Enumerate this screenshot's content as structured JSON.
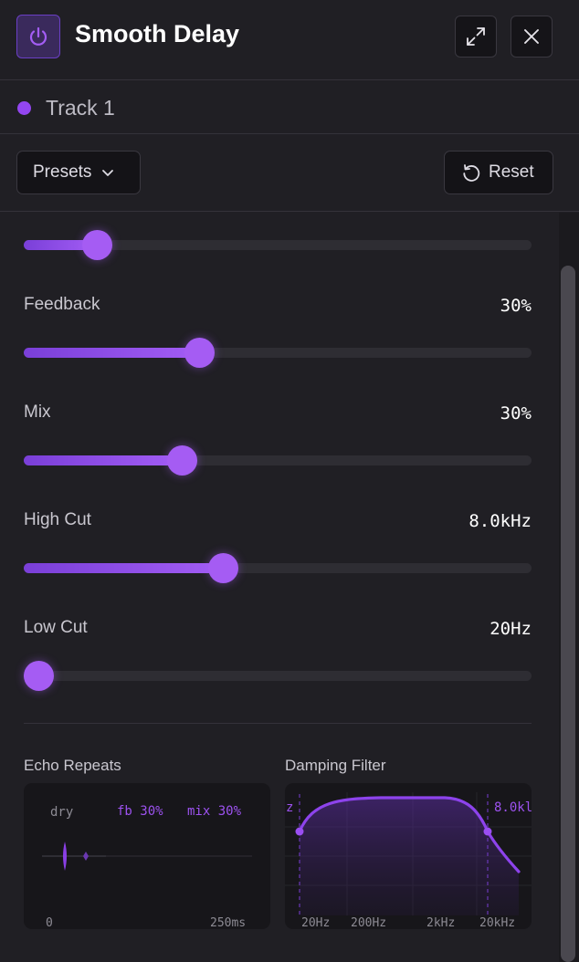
{
  "header": {
    "title": "Smooth Delay",
    "power_icon": "power-icon",
    "expand_icon": "expand-icon",
    "close_icon": "close-icon"
  },
  "track": {
    "label": "Track 1",
    "dot_color": "#9346f0"
  },
  "toolbar": {
    "presets_label": "Presets",
    "reset_label": "Reset"
  },
  "params": [
    {
      "label": "",
      "value": "",
      "level": 0.143
    },
    {
      "label": "Feedback",
      "value": "30%",
      "level": 0.345
    },
    {
      "label": "Mix",
      "value": "30%",
      "level": 0.311
    },
    {
      "label": "High Cut",
      "value": "8.0kHz",
      "level": 0.392
    },
    {
      "label": "Low Cut",
      "value": "20Hz",
      "level": 0.028
    }
  ],
  "echo": {
    "title": "Echo Repeats",
    "dry_label": "dry",
    "fb_label": "fb 30%",
    "mix_label": "mix 30%",
    "axis_start": "0",
    "axis_end": "250ms"
  },
  "damping": {
    "title": "Damping Filter",
    "left_marker": "z",
    "right_marker": "8.0kl",
    "ticks": [
      "20Hz",
      "200Hz",
      "2kHz",
      "20kHz"
    ]
  },
  "colors": {
    "accent": "#a55cf3",
    "accent_dark": "#7a3fd8",
    "background": "#201f24"
  }
}
